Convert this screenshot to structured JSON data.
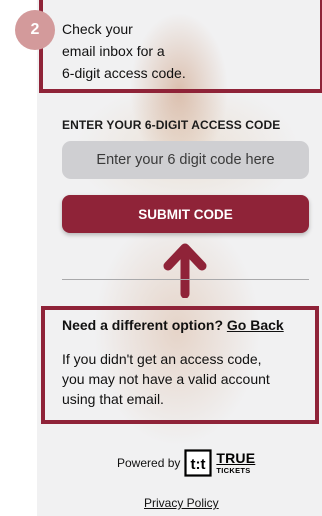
{
  "step": {
    "number": "2",
    "instruction_lines": [
      "Check your",
      "email inbox for a",
      "6-digit access code."
    ]
  },
  "access_code": {
    "label": "ENTER YOUR 6-DIGIT ACCESS CODE",
    "placeholder": "Enter your 6 digit code here",
    "value": ""
  },
  "submit": {
    "label": "SUBMIT CODE"
  },
  "different_option": {
    "heading": "Need a different option?",
    "link_label": "Go Back",
    "body_lines": [
      "If you didn't get an access code,",
      "you may not have a valid account",
      "using that email."
    ]
  },
  "footer": {
    "powered_by": "Powered by",
    "logo_letters": "t:t",
    "logo_word_1": "TRUE",
    "logo_word_2": "TICKETS",
    "privacy_label": "Privacy Policy"
  },
  "colors": {
    "accent": "#8f2338",
    "badge": "#d39a9b",
    "input_bg": "#cfcfd2",
    "panel_bg": "#f1f1f2"
  },
  "icons": {
    "annotation_arrow": "arrow-up-icon",
    "brand_logo": "true-tickets-logo-icon"
  }
}
